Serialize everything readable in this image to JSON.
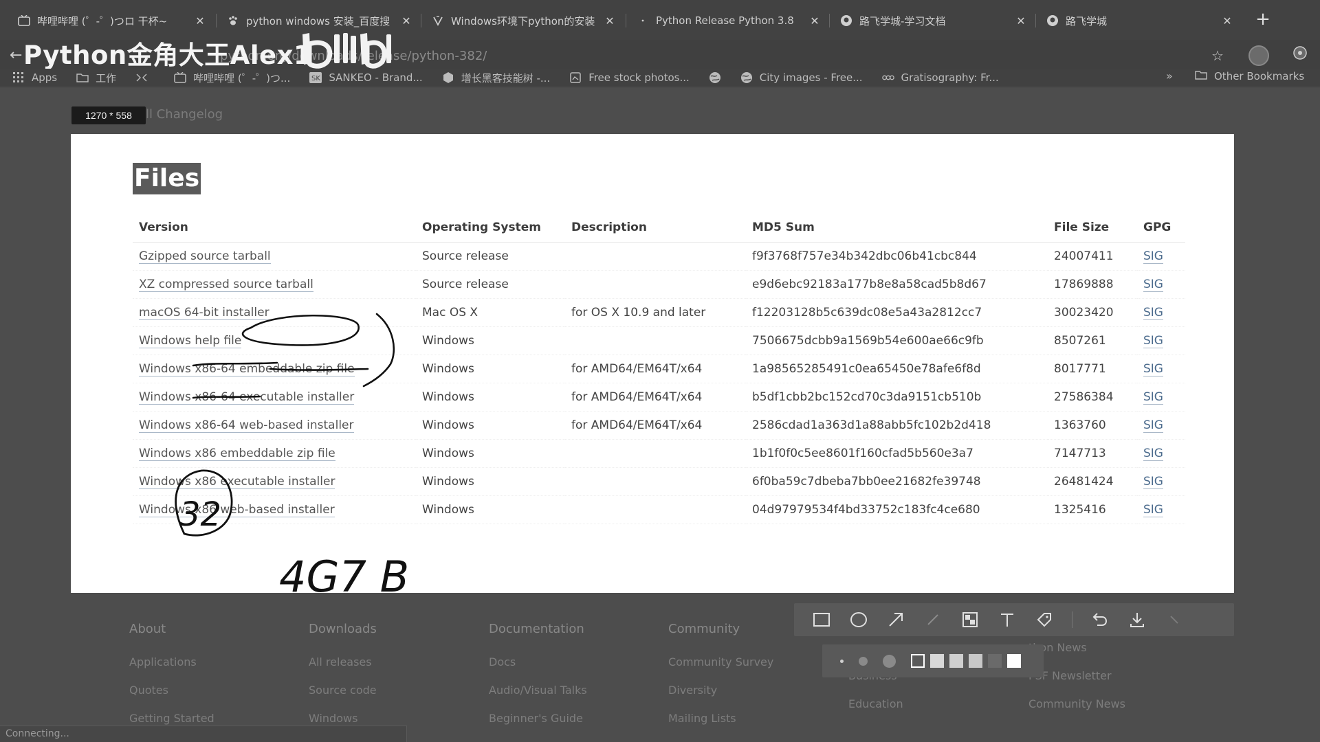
{
  "tabs": [
    {
      "title": "哔哩哔哩 (゜-゜)つロ 干杯~",
      "icon": "bilibili-tv-icon"
    },
    {
      "title": "python windows 安装_百度搜",
      "icon": "baidu-paw-icon"
    },
    {
      "title": "Windows环境下python的安装",
      "icon": "csdn-icon"
    },
    {
      "title": "Python Release Python 3.8",
      "icon": "python-icon"
    },
    {
      "title": "路飞学城-学习文档",
      "icon": "luffy-icon"
    },
    {
      "title": "路飞学城",
      "icon": "luffy-icon"
    }
  ],
  "new_tab": "+",
  "overlay": {
    "title": "Python金角大王Alex1",
    "brand": "bilibili"
  },
  "omnibox": {
    "url_fragment": "/python-382/",
    "visible_text": "python.org/downloads/release/python-382/"
  },
  "bookmarks": [
    {
      "label": "Apps",
      "icon": "apps-grid-icon"
    },
    {
      "label": "工作",
      "icon": "folder-icon"
    },
    {
      "label": "",
      "icon": "bookmark-icon"
    },
    {
      "label": "哔哩哔哩 (゜-゜)つ...",
      "icon": "bilibili-tv-icon"
    },
    {
      "label": "SANKEO - Brand...",
      "icon": "sankeo-icon"
    },
    {
      "label": "增长黑客技能树 -...",
      "icon": "hexagon-icon"
    },
    {
      "label": "Free stock photos...",
      "icon": "photo-icon"
    },
    {
      "label": "",
      "icon": "globe-icon"
    },
    {
      "label": "City images - Free...",
      "icon": "globe-icon"
    },
    {
      "label": "Gratisography: Fr...",
      "icon": "gratisography-icon"
    }
  ],
  "bookmarks_more": "»",
  "other_bookmarks": "Other Bookmarks",
  "capture_size": "1270 * 558",
  "changelog_text": "ll Changelog",
  "files": {
    "heading": "Files",
    "columns": [
      "Version",
      "Operating System",
      "Description",
      "MD5 Sum",
      "File Size",
      "GPG"
    ],
    "rows": [
      {
        "version": "Gzipped source tarball",
        "os": "Source release",
        "desc": "",
        "md5": "f9f3768f757e34b342dbc06b41cbc844",
        "size": "24007411",
        "gpg": "SIG"
      },
      {
        "version": "XZ compressed source tarball",
        "os": "Source release",
        "desc": "",
        "md5": "e9d6ebc92183a177b8e8a58cad5b8d67",
        "size": "17869888",
        "gpg": "SIG"
      },
      {
        "version": "macOS 64-bit installer",
        "os": "Mac OS X",
        "desc": "for OS X 10.9 and later",
        "md5": "f12203128b5c639dc08e5a43a2812cc7",
        "size": "30023420",
        "gpg": "SIG"
      },
      {
        "version": "Windows help file",
        "os": "Windows",
        "desc": "",
        "md5": "7506675dcbb9a1569b54e600ae66c9fb",
        "size": "8507261",
        "gpg": "SIG"
      },
      {
        "version": "Windows x86-64 embeddable zip file",
        "os": "Windows",
        "desc": "for AMD64/EM64T/x64",
        "md5": "1a98565285491c0ea65450e78afe6f8d",
        "size": "8017771",
        "gpg": "SIG"
      },
      {
        "version": "Windows x86-64 executable installer",
        "os": "Windows",
        "desc": "for AMD64/EM64T/x64",
        "md5": "b5df1cbb2bc152cd70c3da9151cb510b",
        "size": "27586384",
        "gpg": "SIG"
      },
      {
        "version": "Windows x86-64 web-based installer",
        "os": "Windows",
        "desc": "for AMD64/EM64T/x64",
        "md5": "2586cdad1a363d1a88abb5fc102b2d418",
        "size": "1363760",
        "gpg": "SIG"
      },
      {
        "version": "Windows x86 embeddable zip file",
        "os": "Windows",
        "desc": "",
        "md5": "1b1f0f0c5ee8601f160cfad5b560e3a7",
        "size": "7147713",
        "gpg": "SIG"
      },
      {
        "version": "Windows x86 executable installer",
        "os": "Windows",
        "desc": "",
        "md5": "6f0ba59c7dbeba7bb0ee21682fe39748",
        "size": "26481424",
        "gpg": "SIG"
      },
      {
        "version": "Windows x86 web-based installer",
        "os": "Windows",
        "desc": "",
        "md5": "04d97979534f4bd33752c183fc4ce680",
        "size": "1325416",
        "gpg": "SIG"
      }
    ]
  },
  "handwriting": {
    "circled": "32",
    "note": "4G7 B"
  },
  "footer": [
    {
      "heading": "About",
      "links": [
        "Applications",
        "Quotes",
        "Getting Started"
      ]
    },
    {
      "heading": "Downloads",
      "links": [
        "All releases",
        "Source code",
        "Windows"
      ]
    },
    {
      "heading": "Documentation",
      "links": [
        "Docs",
        "Audio/Visual Talks",
        "Beginner's Guide"
      ]
    },
    {
      "heading": "Community",
      "links": [
        "Community Survey",
        "Diversity",
        "Mailing Lists"
      ]
    },
    {
      "heading": "",
      "links": [
        "",
        "Business",
        "Education"
      ]
    },
    {
      "heading": "",
      "links": [
        "thon News",
        "PSF Newsletter",
        "Community News"
      ]
    }
  ],
  "tool_toolbar": {
    "tools": [
      "rectangle-tool-icon",
      "ellipse-tool-icon",
      "arrow-tool-icon",
      "pen-tool-icon",
      "mosaic-tool-icon",
      "text-tool-icon",
      "tag-tool-icon",
      "undo-icon",
      "download-icon",
      "more-icon"
    ],
    "brush_sizes": [
      "small",
      "medium",
      "large"
    ],
    "swatches": [
      "#ffffff",
      "#d8d8d8",
      "#cfcfcf",
      "#c8c8c8",
      "#6a6a6a",
      "#ffffff"
    ]
  },
  "status": "Connecting..."
}
